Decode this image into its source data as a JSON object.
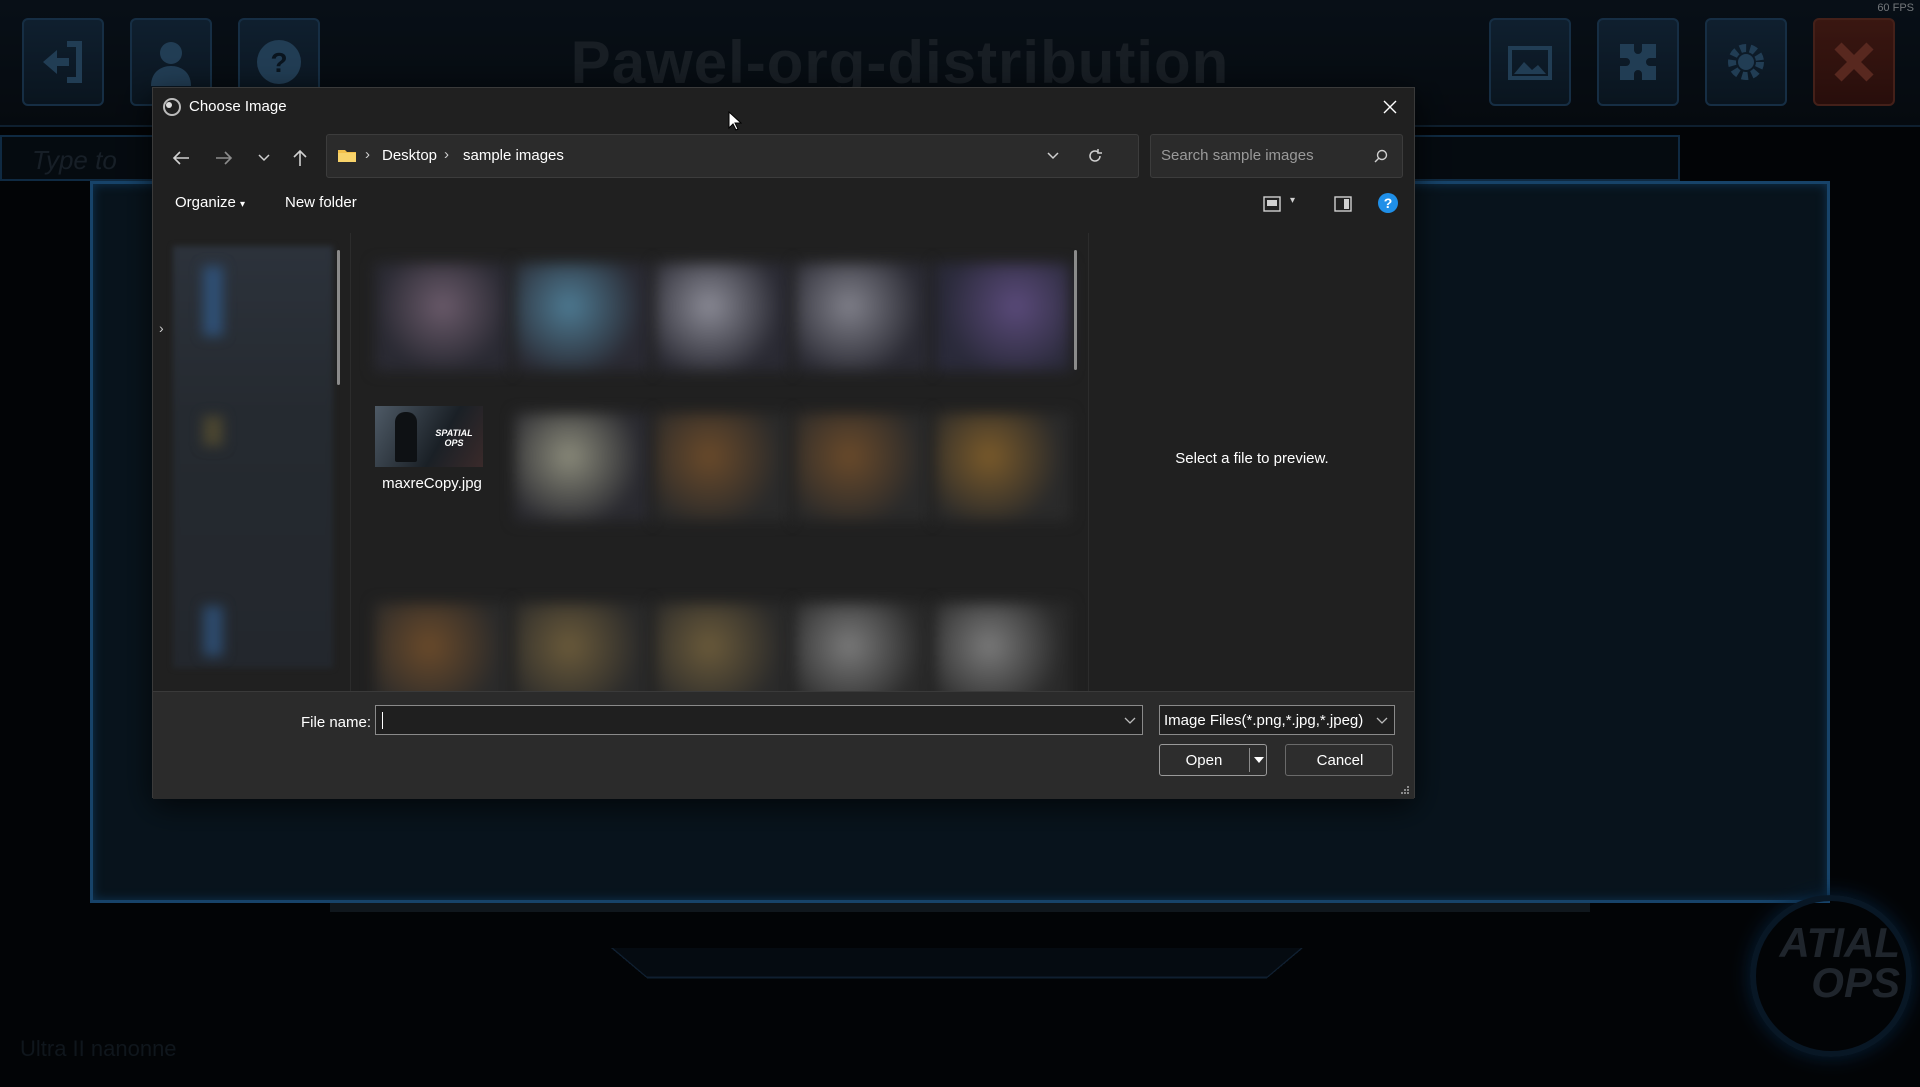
{
  "background": {
    "fps": "60 FPS",
    "game_title": "Pawel-org-distribution",
    "type_bar_text": "Type to",
    "logo_text": "ATIAL OPS",
    "footer_text": "Ultra II nanonne"
  },
  "dialog": {
    "title": "Choose Image",
    "breadcrumb": [
      "Desktop",
      "sample images"
    ],
    "search_placeholder": "Search sample images",
    "organize_label": "Organize",
    "new_folder_label": "New folder",
    "files": [
      {
        "name": "maxreCopy.jpg",
        "thumb_text": "SPATIAL OPS"
      }
    ],
    "preview_text": "Select a file to preview.",
    "file_name_label": "File name:",
    "file_name_value": "",
    "file_type_filter": "Image Files(*.png,*.jpg,*.jpeg)",
    "open_label": "Open",
    "cancel_label": "Cancel"
  },
  "icons": [
    "back-arrow-icon",
    "forward-arrow-icon",
    "recent-locations-chevron-icon",
    "up-arrow-icon",
    "folder-icon",
    "refresh-icon",
    "search-icon",
    "view-options-icon",
    "preview-pane-icon",
    "help-icon",
    "close-icon"
  ],
  "colors": {
    "dialog_bg": "#202020",
    "footer_bg": "#2b2b2b",
    "panel_border": "#2a7bc0",
    "help_blue": "#1f8fe8"
  }
}
